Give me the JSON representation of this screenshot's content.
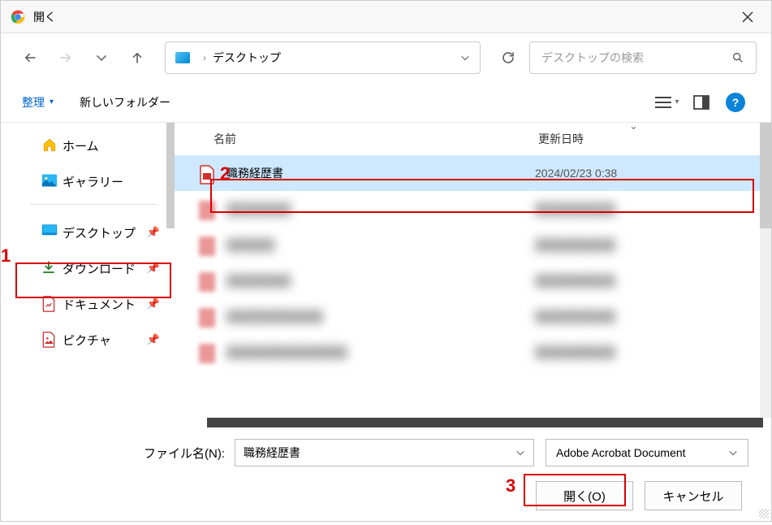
{
  "title": "開く",
  "address": {
    "location": "デスクトップ"
  },
  "search": {
    "placeholder": "デスクトップの検索"
  },
  "toolbar": {
    "organize": "整理",
    "newfolder": "新しいフォルダー"
  },
  "sidebar": {
    "home": "ホーム",
    "gallery": "ギャラリー",
    "desktop": "デスクトップ",
    "downloads": "ダウンロード",
    "documents": "ドキュメント",
    "pictures": "ピクチャ"
  },
  "columns": {
    "name": "名前",
    "date": "更新日時"
  },
  "files": {
    "selected": {
      "name": "職務経歴書",
      "date": "2024/02/23 0:38"
    },
    "blurred": [
      {
        "name": "████████",
        "date": "██████████"
      },
      {
        "name": "██████",
        "date": "██████████"
      },
      {
        "name": "████████",
        "date": "██████████"
      },
      {
        "name": "████████████",
        "date": "██████████"
      },
      {
        "name": "███████████████",
        "date": "██████████"
      }
    ]
  },
  "footer": {
    "filename_label": "ファイル名(N):",
    "filename_value": "職務経歴書",
    "filetype": "Adobe Acrobat Document",
    "open": "開く(O)",
    "cancel": "キャンセル"
  },
  "annotations": {
    "a1": "1",
    "a2": "2",
    "a3": "3"
  }
}
